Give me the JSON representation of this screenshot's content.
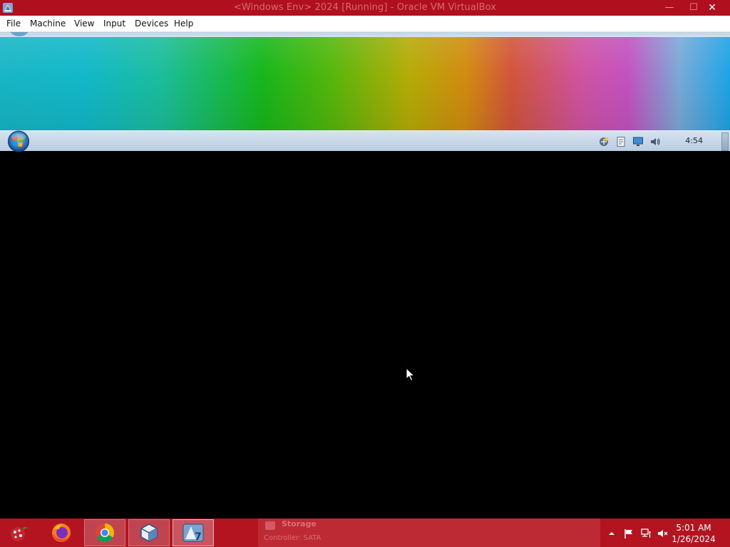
{
  "window": {
    "title": "<Windows Env> 2024 [Running] - Oracle VM VirtualBox",
    "minimize_glyph": "—",
    "maximize_glyph": "☐",
    "close_glyph": "✕"
  },
  "menubar": {
    "items": [
      "File",
      "Machine",
      "View",
      "Input",
      "Devices",
      "Help"
    ]
  },
  "guest": {
    "taskbar_clock": "4:54"
  },
  "host_taskbar": {
    "ghost_window_title": "Storage",
    "ghost_window_subtitle": "Controller: SATA",
    "clock_time": "5:01 AM",
    "clock_date": "1/26/2024"
  },
  "icons": {
    "titlebar": "virtualbox-icon",
    "guest_tray": [
      "network-icon",
      "action-center-icon",
      "display-icon",
      "volume-icon"
    ],
    "host_tray": [
      "chevron-up-icon",
      "flag-icon",
      "network-icon",
      "volume-muted-icon"
    ],
    "taskbar_apps": [
      "start-icon",
      "firefox-icon",
      "chrome-icon",
      "virtualbox-icon",
      "windows7-vm-icon"
    ]
  },
  "colors": {
    "host_accent": "#b0101e",
    "host_close": "#ffffff"
  }
}
